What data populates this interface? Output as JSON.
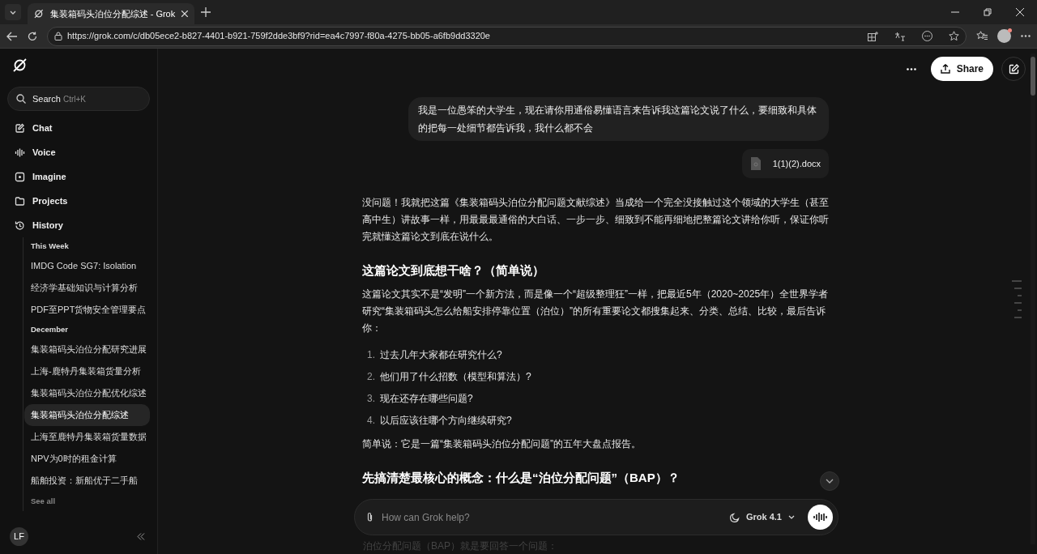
{
  "browser": {
    "tabs": [
      {
        "title": "集装箱码头泊位分配综述 - Grok",
        "selected": true
      }
    ],
    "url": "https://grok.com/c/db05ece2-b827-4401-b921-759f2dde3bf9?rid=ea4c7997-f80a-4275-bb05-a6fb9dd3320e"
  },
  "sidebar": {
    "search": {
      "label": "Search",
      "shortcut": "Ctrl+K"
    },
    "nav": [
      {
        "label": "Chat"
      },
      {
        "label": "Voice"
      },
      {
        "label": "Imagine"
      },
      {
        "label": "Projects"
      },
      {
        "label": "History"
      }
    ],
    "history": [
      {
        "heading": "This Week",
        "items": [
          {
            "title": "IMDG Code SG7: Isolation",
            "selected": false
          },
          {
            "title": "经济学基础知识与计算分析",
            "selected": false
          },
          {
            "title": "PDF至PPT货物安全管理要点",
            "selected": false
          }
        ]
      },
      {
        "heading": "December",
        "items": [
          {
            "title": "集装箱码头泊位分配研究进展",
            "selected": false
          },
          {
            "title": "上海-鹿特丹集装箱货量分析",
            "selected": false
          },
          {
            "title": "集装箱码头泊位分配优化综述",
            "selected": false
          },
          {
            "title": "集装箱码头泊位分配综述",
            "selected": true
          },
          {
            "title": "上海至鹿特丹集装箱货量数据",
            "selected": false
          },
          {
            "title": "NPV为0时的租金计算",
            "selected": false
          },
          {
            "title": "船舶投资：新船优于二手船",
            "selected": false
          }
        ]
      }
    ],
    "see_all": "See all",
    "user_initials": "LF"
  },
  "header": {
    "share": "Share"
  },
  "user_message": {
    "text": "我是一位愚笨的大学生，现在请你用通俗易懂语言来告诉我这篇论文说了什么，要细致和具体的把每一处细节都告诉我，我什么都不会",
    "attachment": "1(1)(2).docx"
  },
  "response": [
    {
      "kind": "paragraph",
      "text": "没问题！我就把这篇《集装箱码头泊位分配问题文献综述》当成给一个完全没接触过这个领域的大学生（甚至高中生）讲故事一样，用最最最通俗的大白话、一步一步、细致到不能再细地把整篇论文讲给你听，保证你听完就懂这篇论文到底在说什么。"
    },
    {
      "kind": "heading",
      "text": "这篇论文到底想干啥？（简单说）"
    },
    {
      "kind": "paragraph",
      "text": "这篇论文其实不是“发明”一个新方法，而是像一个“超级整理狂”一样，把最近5年（2020~2025年）全世界学者研究“集装箱码头怎么给船安排停靠位置（泊位）”的所有重要论文都搜集起来、分类、总结、比较，最后告诉你："
    },
    {
      "kind": "list",
      "items": [
        {
          "number": "1.",
          "text": "过去几年大家都在研究什么?"
        },
        {
          "number": "2.",
          "text": "他们用了什么招数（模型和算法）?"
        },
        {
          "number": "3.",
          "text": "现在还存在哪些问题?"
        },
        {
          "number": "4.",
          "text": "以后应该往哪个方向继续研究?"
        }
      ]
    },
    {
      "kind": "paragraph",
      "text": "简单说：它是一篇“集装箱码头泊位分配问题”的五年大盘点报告。"
    },
    {
      "kind": "heading",
      "text": "先搞清楚最核心的概念：什么是“泊位分配问题”（BAP）？"
    }
  ],
  "faded_line": "泊位分配问题（BAP）就是要回答一个问题：",
  "composer": {
    "placeholder": "How can Grok help?",
    "model": "Grok 4.1"
  }
}
